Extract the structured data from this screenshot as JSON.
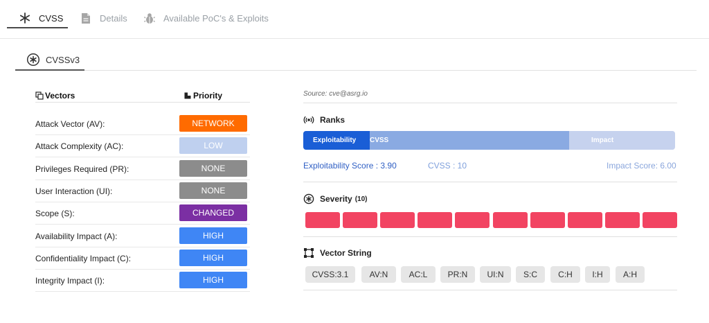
{
  "top_tabs": [
    {
      "label": "CVSS",
      "icon": "asterisk-icon"
    },
    {
      "label": "Details",
      "icon": "document-icon"
    },
    {
      "label": "Available PoC's & Exploits",
      "icon": "bug-icon"
    }
  ],
  "sub_tabs": [
    {
      "label": "CVSSv3",
      "icon": "circled-asterisk-icon"
    }
  ],
  "vectors": {
    "header_vectors": "Vectors",
    "header_priority": "Priority",
    "rows": [
      {
        "label": "Attack Vector (AV):",
        "value": "NETWORK",
        "color": "#ff6b00"
      },
      {
        "label": "Attack Complexity (AC):",
        "value": "LOW",
        "color": "#bfd0ef"
      },
      {
        "label": "Privileges Required (PR):",
        "value": "NONE",
        "color": "#8c8c8c"
      },
      {
        "label": "User Interaction (UI):",
        "value": "NONE",
        "color": "#8c8c8c"
      },
      {
        "label": "Scope (S):",
        "value": "CHANGED",
        "color": "#7b2fa3"
      },
      {
        "label": "Availability Impact (A):",
        "value": "HIGH",
        "color": "#3f86f5"
      },
      {
        "label": "Confidentiality Impact (C):",
        "value": "HIGH",
        "color": "#3f86f5"
      },
      {
        "label": "Integrity Impact (I):",
        "value": "HIGH",
        "color": "#3f86f5"
      }
    ]
  },
  "source": "Source: cve@asrg.io",
  "ranks": {
    "title": "Ranks",
    "bar_exploitability": "Exploitability",
    "bar_cvss": "CVSS",
    "bar_impact": "Impact",
    "exploitability_score": "Exploitability Score : 3.90",
    "cvss_score": "CVSS : 10",
    "impact_score": "Impact Score: 6.00"
  },
  "severity": {
    "title": "Severity",
    "count": "(10)",
    "level": 10,
    "color": "#f24462"
  },
  "vector_string": {
    "title": "Vector String",
    "chips": [
      "CVSS:3.1",
      "AV:N",
      "AC:L",
      "PR:N",
      "UI:N",
      "S:C",
      "C:H",
      "I:H",
      "A:H"
    ]
  }
}
